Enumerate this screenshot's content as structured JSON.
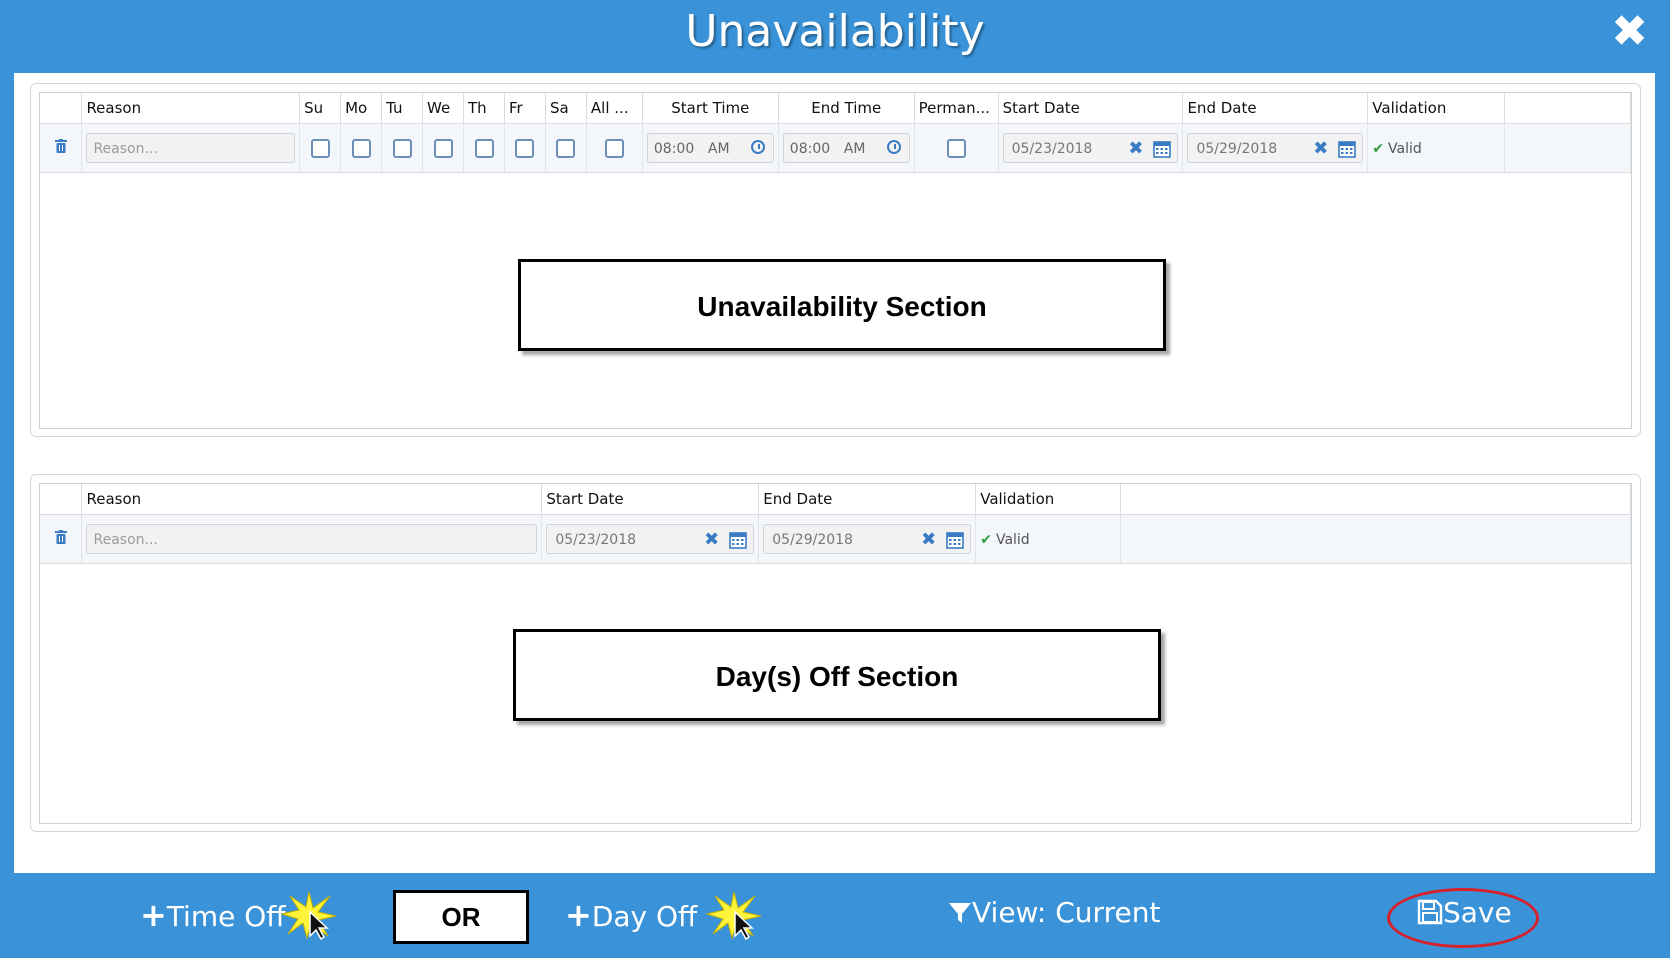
{
  "window": {
    "title": "Unavailability",
    "close_glyph": "✖"
  },
  "unavailability": {
    "headers": {
      "reason": "Reason",
      "su": "Su",
      "mo": "Mo",
      "tu": "Tu",
      "we": "We",
      "th": "Th",
      "fr": "Fr",
      "sa": "Sa",
      "all": "All ...",
      "start_time": "Start Time",
      "end_time": "End Time",
      "permanent": "Perman...",
      "start_date": "Start Date",
      "end_date": "End Date",
      "validation": "Validation"
    },
    "row": {
      "reason_placeholder": "Reason...",
      "start_time": "08:00",
      "start_ampm": "AM",
      "end_time": "08:00",
      "end_ampm": "AM",
      "start_date": "05/23/2018",
      "end_date": "05/29/2018",
      "validation": "Valid"
    },
    "section_label": "Unavailability Section"
  },
  "days_off": {
    "headers": {
      "reason": "Reason",
      "start_date": "Start Date",
      "end_date": "End Date",
      "validation": "Validation"
    },
    "row": {
      "reason_placeholder": "Reason...",
      "start_date": "05/23/2018",
      "end_date": "05/29/2018",
      "validation": "Valid"
    },
    "section_label": "Day(s) Off Section"
  },
  "footer": {
    "time_off": "Time Off",
    "or": "OR",
    "day_off": "Day Off",
    "view": "View: Current",
    "save": "Save"
  },
  "colors": {
    "accent": "#3a93d8",
    "icon_blue": "#3a7cc4",
    "valid_green": "#2e9c3e",
    "highlight_red": "#d6202a"
  }
}
